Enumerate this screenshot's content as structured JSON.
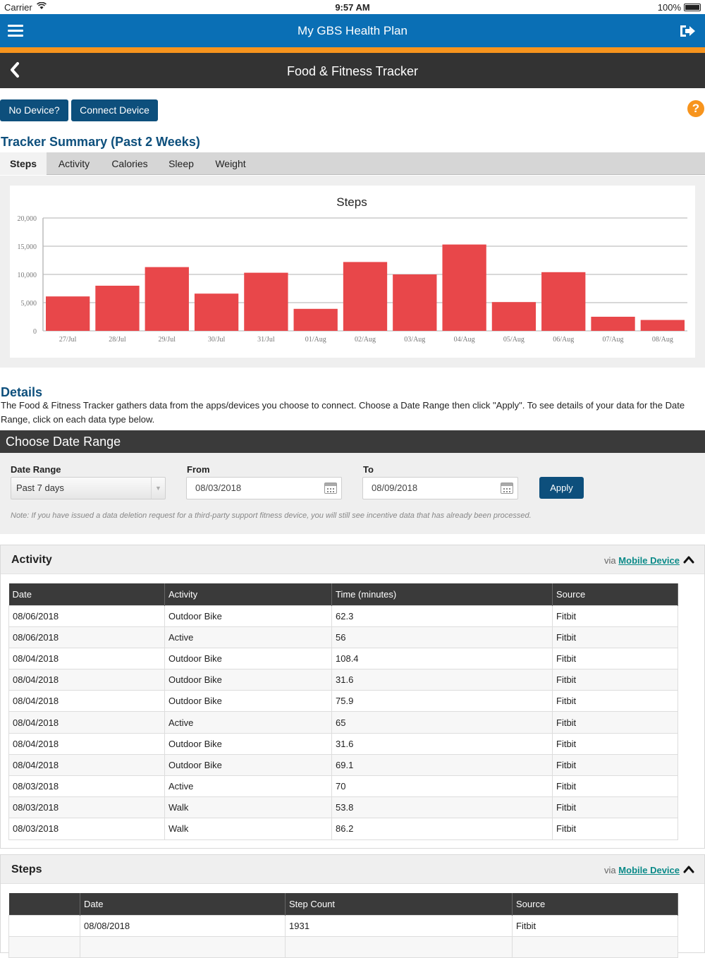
{
  "status": {
    "carrier": "Carrier",
    "time": "9:57 AM",
    "battery": "100%"
  },
  "header": {
    "title": "My GBS Health Plan"
  },
  "page": {
    "title": "Food & Fitness Tracker"
  },
  "actions": {
    "no_device": "No Device?",
    "connect_device": "Connect Device",
    "help": "?"
  },
  "summary": {
    "title": "Tracker Summary (Past 2 Weeks)",
    "tabs": [
      "Steps",
      "Activity",
      "Calories",
      "Sleep",
      "Weight"
    ],
    "active_tab": "Steps"
  },
  "chart_data": {
    "type": "bar",
    "title": "Steps",
    "categories": [
      "27/Jul",
      "28/Jul",
      "29/Jul",
      "30/Jul",
      "31/Jul",
      "01/Aug",
      "02/Aug",
      "03/Aug",
      "04/Aug",
      "05/Aug",
      "06/Aug",
      "07/Aug",
      "08/Aug"
    ],
    "values": [
      6100,
      8000,
      11300,
      6600,
      10300,
      3900,
      12200,
      10000,
      15300,
      5100,
      10400,
      2500,
      1931
    ],
    "ylim": [
      0,
      20000
    ],
    "yticks": [
      0,
      5000,
      10000,
      15000,
      20000
    ],
    "ytick_labels": [
      "0",
      "5,000",
      "10,000",
      "15,000",
      "20,000"
    ],
    "xlabel": "",
    "ylabel": "",
    "grid": true,
    "color": "#e8474a"
  },
  "details": {
    "title": "Details",
    "text": "The Food & Fitness Tracker gathers data from the apps/devices you choose to connect. Choose a Date Range then click \"Apply\". To see details of your data for the Date Range, click on each data type below."
  },
  "date_range": {
    "title": "Choose Date Range",
    "range_label": "Date Range",
    "range_value": "Past 7 days",
    "from_label": "From",
    "from_value": "08/03/2018",
    "to_label": "To",
    "to_value": "08/09/2018",
    "apply": "Apply",
    "note": "Note: If you have issued a data deletion request for a third-party support fitness device, you will still see incentive data that has already been processed."
  },
  "activity": {
    "title": "Activity",
    "via": "via",
    "via_link": "Mobile Device",
    "columns": [
      "Date",
      "Activity",
      "Time (minutes)",
      "Source"
    ],
    "rows": [
      [
        "08/06/2018",
        "Outdoor Bike",
        "62.3",
        "Fitbit"
      ],
      [
        "08/06/2018",
        "Active",
        "56",
        "Fitbit"
      ],
      [
        "08/04/2018",
        "Outdoor Bike",
        "108.4",
        "Fitbit"
      ],
      [
        "08/04/2018",
        "Outdoor Bike",
        "31.6",
        "Fitbit"
      ],
      [
        "08/04/2018",
        "Outdoor Bike",
        "75.9",
        "Fitbit"
      ],
      [
        "08/04/2018",
        "Active",
        "65",
        "Fitbit"
      ],
      [
        "08/04/2018",
        "Outdoor Bike",
        "31.6",
        "Fitbit"
      ],
      [
        "08/04/2018",
        "Outdoor Bike",
        "69.1",
        "Fitbit"
      ],
      [
        "08/03/2018",
        "Active",
        "70",
        "Fitbit"
      ],
      [
        "08/03/2018",
        "Walk",
        "53.8",
        "Fitbit"
      ],
      [
        "08/03/2018",
        "Walk",
        "86.2",
        "Fitbit"
      ]
    ]
  },
  "steps": {
    "title": "Steps",
    "via": "via",
    "via_link": "Mobile Device",
    "columns": [
      "",
      "Date",
      "Step Count",
      "Source"
    ],
    "rows": [
      [
        "",
        "08/08/2018",
        "1931",
        "Fitbit"
      ],
      [
        "",
        "",
        "",
        ""
      ]
    ]
  }
}
